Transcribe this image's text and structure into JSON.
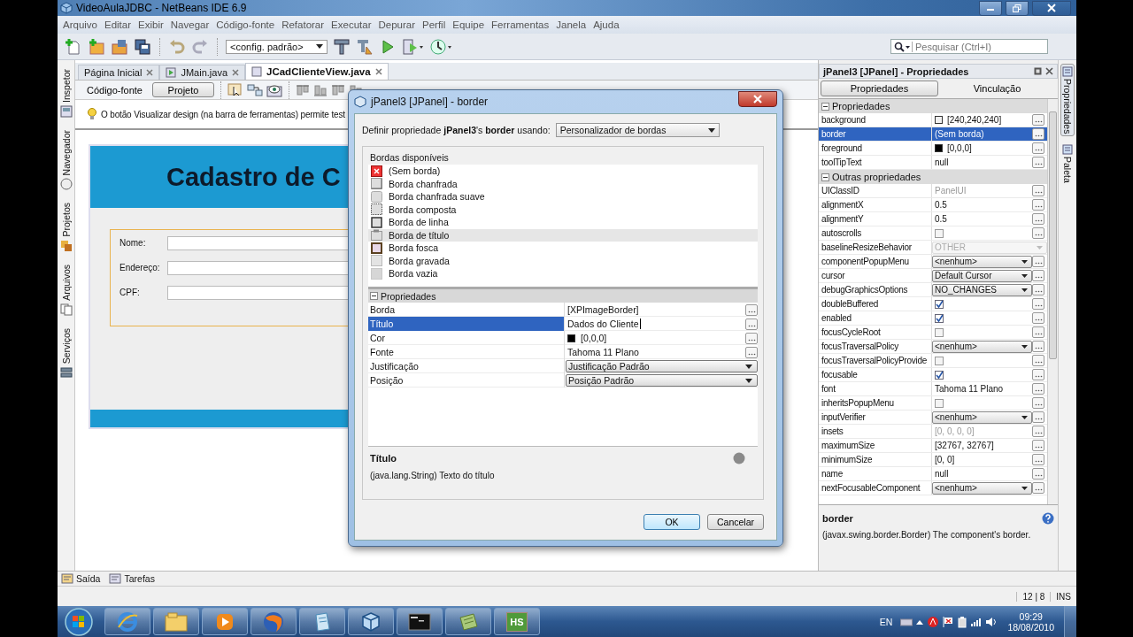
{
  "window": {
    "title": "VideoAulaJDBC - NetBeans IDE 6.9"
  },
  "menu": [
    "Arquivo",
    "Editar",
    "Exibir",
    "Navegar",
    "Código-fonte",
    "Refatorar",
    "Executar",
    "Depurar",
    "Perfil",
    "Equipe",
    "Ferramentas",
    "Janela",
    "Ajuda"
  ],
  "toolbar": {
    "config": "<config. padrão>",
    "search_placeholder": "Pesquisar (Ctrl+I)"
  },
  "left_strip": [
    {
      "label": "Inspetor",
      "kind": "inspector"
    },
    {
      "label": "Navegador",
      "kind": "navigator"
    },
    {
      "label": "Projetos",
      "kind": "projects"
    },
    {
      "label": "Arquivos",
      "kind": "files"
    },
    {
      "label": "Serviços",
      "kind": "services"
    }
  ],
  "editor_tabs": [
    {
      "label": "Página Inicial",
      "selected": false
    },
    {
      "label": "JMain.java",
      "selected": false
    },
    {
      "label": "JCadClienteView.java",
      "selected": true
    }
  ],
  "view_toggle": [
    {
      "label": "Código-fonte",
      "selected": false
    },
    {
      "label": "Projeto",
      "selected": true
    }
  ],
  "hint": "O botão Visualizar design (na barra de ferramentas) permite test",
  "form": {
    "title": "Cadastro de C",
    "fields": [
      "Nome:",
      "Endereço:",
      "CPF:"
    ]
  },
  "dialog": {
    "title": "jPanel3 [JPanel] - border",
    "prompt": "Definir propriedade **jPanel3**'s **border** usando:",
    "editor": "Personalizador de bordas",
    "list_label": "Bordas disponíveis",
    "borders": [
      {
        "label": "(Sem borda)",
        "kind": "none",
        "selected": false
      },
      {
        "label": "Borda chanfrada",
        "kind": "bevel",
        "selected": false
      },
      {
        "label": "Borda chanfrada suave",
        "kind": "soft",
        "selected": false
      },
      {
        "label": "Borda composta",
        "kind": "compound",
        "selected": false
      },
      {
        "label": "Borda de linha",
        "kind": "line",
        "selected": false
      },
      {
        "label": "Borda de título",
        "kind": "titled",
        "selected": true
      },
      {
        "label": "Borda fosca",
        "kind": "matte",
        "selected": false
      },
      {
        "label": "Borda gravada",
        "kind": "etched",
        "selected": false
      },
      {
        "label": "Borda vazia",
        "kind": "empty",
        "selected": false
      }
    ],
    "section": "Propriedades",
    "props": [
      {
        "name": "Borda",
        "value": "[XPImageBorder]",
        "kind": "text",
        "selected": false
      },
      {
        "name": "Título",
        "value": "Dados do Cliente",
        "kind": "edit",
        "selected": true
      },
      {
        "name": "Cor",
        "value": "[0,0,0]",
        "kind": "color",
        "color": "#000000",
        "selected": false
      },
      {
        "name": "Fonte",
        "value": "Tahoma 11 Plano",
        "kind": "text",
        "selected": false
      },
      {
        "name": "Justificação",
        "value": "Justificação Padrão",
        "kind": "combo",
        "selected": false
      },
      {
        "name": "Posição",
        "value": "Posição Padrão",
        "kind": "combo",
        "selected": false
      }
    ],
    "help_title": "Título",
    "help_text": "(java.lang.String) Texto do título",
    "buttons": [
      "OK",
      "Cancelar"
    ]
  },
  "properties_panel": {
    "title": "jPanel3 [JPanel] - Propriedades",
    "tabs": [
      {
        "label": "Propriedades",
        "selected": true
      },
      {
        "label": "Vinculação",
        "selected": false
      }
    ],
    "groups": [
      {
        "name": "Propriedades",
        "rows": [
          {
            "name": "background",
            "value": "[240,240,240]",
            "kind": "color",
            "color": "#f0f0f0",
            "selected": false
          },
          {
            "name": "border",
            "value": "(Sem borda)",
            "kind": "text",
            "selected": true
          },
          {
            "name": "foreground",
            "value": "[0,0,0]",
            "kind": "color",
            "color": "#000000",
            "selected": false
          },
          {
            "name": "toolTipText",
            "value": "null",
            "kind": "text",
            "selected": false
          }
        ]
      },
      {
        "name": "Outras propriedades",
        "rows": [
          {
            "name": "UIClassID",
            "value": "PanelUI",
            "kind": "muted",
            "selected": false
          },
          {
            "name": "alignmentX",
            "value": "0.5",
            "kind": "text",
            "selected": false
          },
          {
            "name": "alignmentY",
            "value": "0.5",
            "kind": "text",
            "selected": false
          },
          {
            "name": "autoscrolls",
            "kind": "check",
            "checked": false,
            "selected": false
          },
          {
            "name": "baselineResizeBehavior",
            "value": "OTHER",
            "kind": "locked",
            "selected": false
          },
          {
            "name": "componentPopupMenu",
            "value": "<nenhum>",
            "kind": "combo",
            "selected": false
          },
          {
            "name": "cursor",
            "value": "Default Cursor",
            "kind": "combo",
            "selected": false
          },
          {
            "name": "debugGraphicsOptions",
            "value": "NO_CHANGES",
            "kind": "combo",
            "selected": false
          },
          {
            "name": "doubleBuffered",
            "kind": "check",
            "checked": true,
            "selected": false
          },
          {
            "name": "enabled",
            "kind": "check",
            "checked": true,
            "selected": false
          },
          {
            "name": "focusCycleRoot",
            "kind": "check",
            "checked": false,
            "selected": false
          },
          {
            "name": "focusTraversalPolicy",
            "value": "<nenhum>",
            "kind": "combo",
            "selected": false
          },
          {
            "name": "focusTraversalPolicyProvide",
            "kind": "check",
            "checked": false,
            "selected": false
          },
          {
            "name": "focusable",
            "kind": "check",
            "checked": true,
            "selected": false
          },
          {
            "name": "font",
            "value": "Tahoma 11 Plano",
            "kind": "text",
            "selected": false
          },
          {
            "name": "inheritsPopupMenu",
            "kind": "check",
            "checked": false,
            "selected": false
          },
          {
            "name": "inputVerifier",
            "value": "<nenhum>",
            "kind": "combo",
            "selected": false
          },
          {
            "name": "insets",
            "value": "[0, 0, 0, 0]",
            "kind": "muted",
            "selected": false
          },
          {
            "name": "maximumSize",
            "value": "[32767, 32767]",
            "kind": "text",
            "selected": false
          },
          {
            "name": "minimumSize",
            "value": "[0, 0]",
            "kind": "text",
            "selected": false
          },
          {
            "name": "name",
            "value": "null",
            "kind": "text",
            "selected": false
          },
          {
            "name": "nextFocusableComponent",
            "value": "<nenhum>",
            "kind": "combo",
            "selected": false
          }
        ]
      }
    ],
    "help_title": "border",
    "help_text": "(javax.swing.border.Border) The component's border."
  },
  "right_strip": [
    {
      "label": "Propriedades",
      "selected": true
    },
    {
      "label": "Paleta",
      "selected": false
    }
  ],
  "bottom_tabs": [
    {
      "label": "Saída",
      "kind": "output"
    },
    {
      "label": "Tarefas",
      "kind": "tasks"
    }
  ],
  "status_bar": {
    "position": "12 | 8",
    "mode": "INS"
  },
  "taskbar": {
    "apps": [
      {
        "kind": "browser"
      },
      {
        "kind": "folder"
      },
      {
        "kind": "media"
      },
      {
        "kind": "globe"
      },
      {
        "kind": "document"
      },
      {
        "kind": "cube"
      },
      {
        "kind": "terminal"
      },
      {
        "kind": "notebook"
      },
      {
        "kind": "badge",
        "label": "HS"
      }
    ],
    "lang": "EN",
    "time": "09:29",
    "date": "18/08/2010"
  }
}
